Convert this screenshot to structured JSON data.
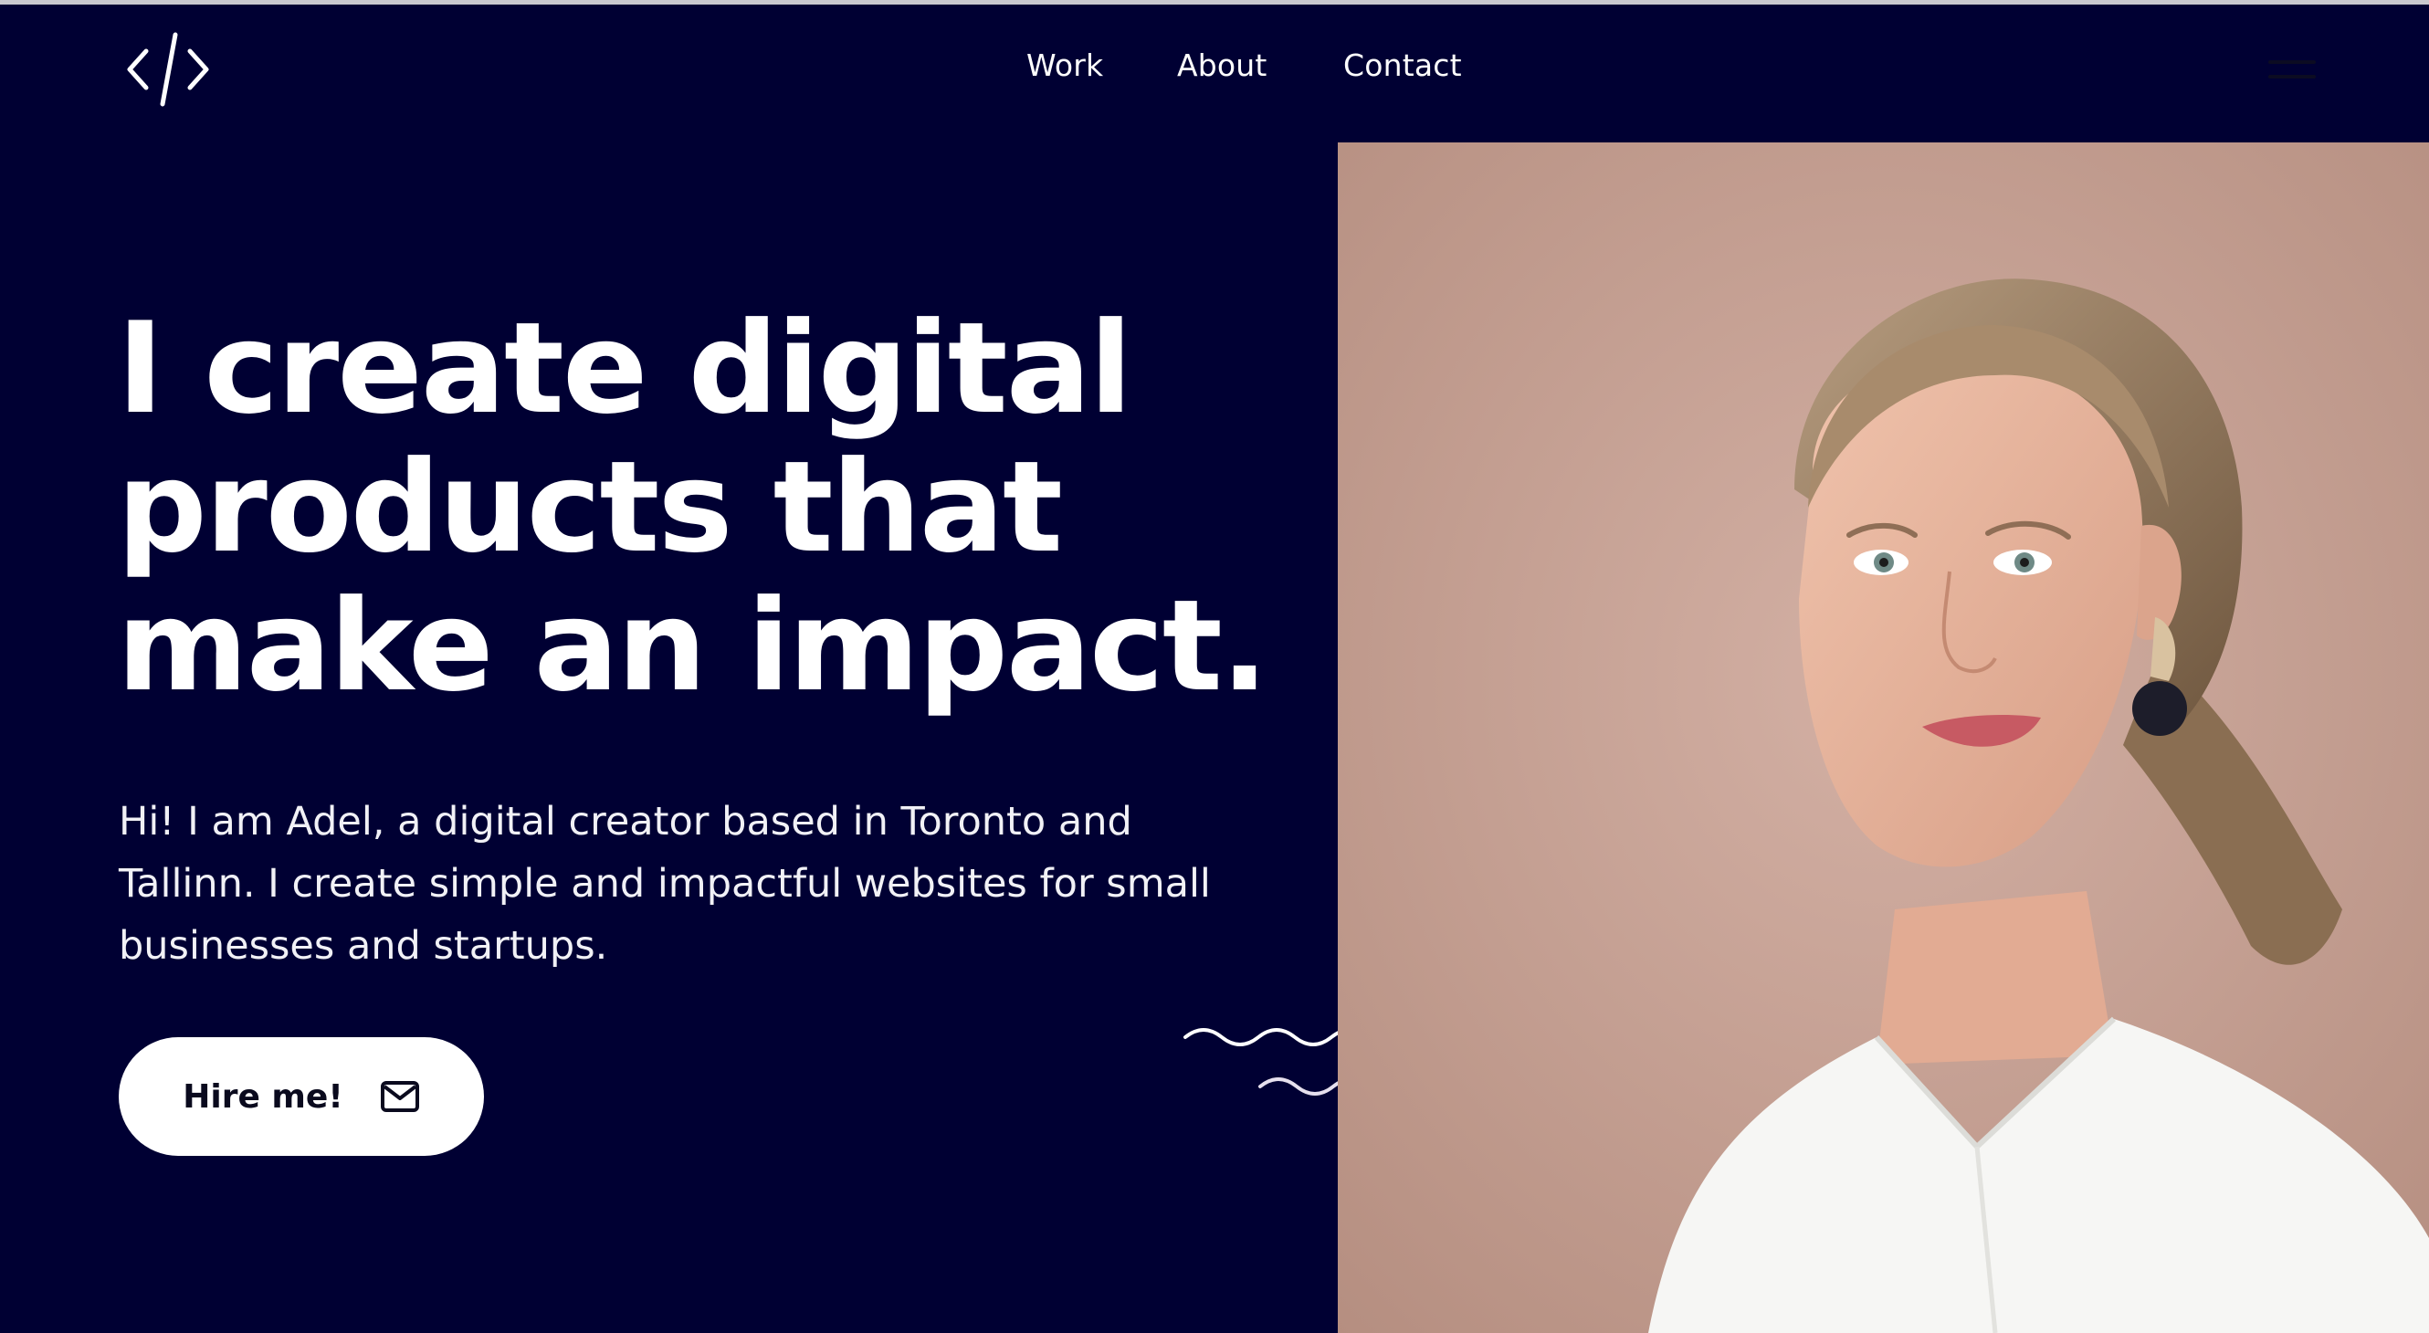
{
  "nav": {
    "items": [
      {
        "label": "Work"
      },
      {
        "label": "About"
      },
      {
        "label": "Contact"
      }
    ]
  },
  "hero": {
    "headline": "I create digital products that make an impact.",
    "intro": "Hi! I am Adel, a digital creator based in Toronto and Tallinn. I create simple and impactful websites for small businesses and startups.",
    "cta_label": "Hire me!"
  },
  "icons": {
    "logo": "code-brackets-icon",
    "menu": "hamburger-menu-icon",
    "cta": "mail-icon",
    "decoration": "wave-lines"
  },
  "colors": {
    "background": "#000033",
    "text": "#ffffff",
    "button_bg": "#ffffff",
    "button_text": "#0a0a1e",
    "photo_backdrop": "#c4a195"
  }
}
